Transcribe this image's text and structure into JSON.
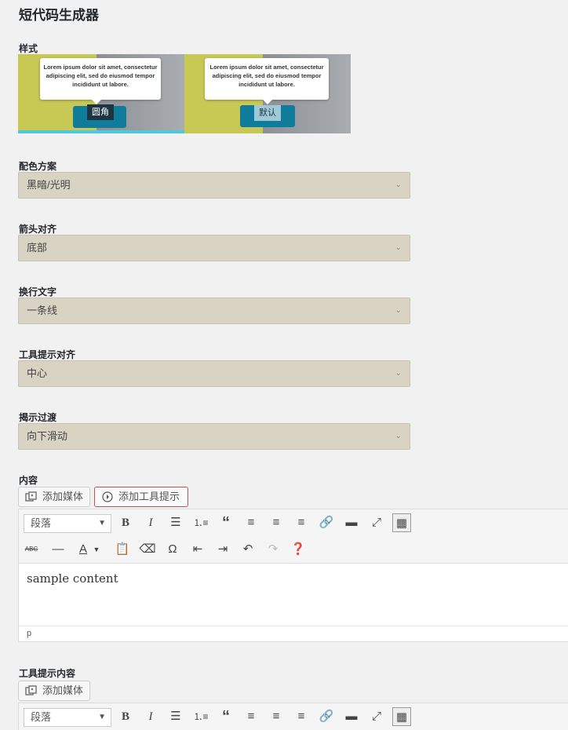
{
  "page_title": "短代码生成器",
  "style_field": {
    "label": "样式",
    "options": [
      {
        "name": "圆角",
        "tooltip_text": "Lorem ipsum dolor sit amet, consectetur adipiscing elit, sed do eiusmod tempor incididunt ut labore.",
        "selected": true
      },
      {
        "name": "默认",
        "tooltip_text": "Lorem ipsum dolor sit amet, consectetur adipiscing elit, sed do eiusmod tempor incididunt ut labore.",
        "selected": false
      }
    ]
  },
  "fields": [
    {
      "label": "配色方案",
      "value": "黑暗/光明"
    },
    {
      "label": "箭头对齐",
      "value": "底部"
    },
    {
      "label": "换行文字",
      "value": "一条线"
    },
    {
      "label": "工具提示对齐",
      "value": "中心"
    },
    {
      "label": "揭示过渡",
      "value": "向下滑动"
    }
  ],
  "content_section": {
    "label": "内容",
    "add_media_label": "添加媒体",
    "add_tooltip_label": "添加工具提示",
    "format_select": "段落",
    "body_text": "sample content",
    "status_path": "p"
  },
  "tooltip_content_section": {
    "label": "工具提示内容",
    "add_media_label": "添加媒体",
    "format_select": "段落"
  },
  "colors": {
    "select_bg": "#d9d3c3",
    "selected_style_bar": "#4fc7dc",
    "thumb_yellow": "#c8c855",
    "tooltip_button": "#0e7c9a"
  }
}
